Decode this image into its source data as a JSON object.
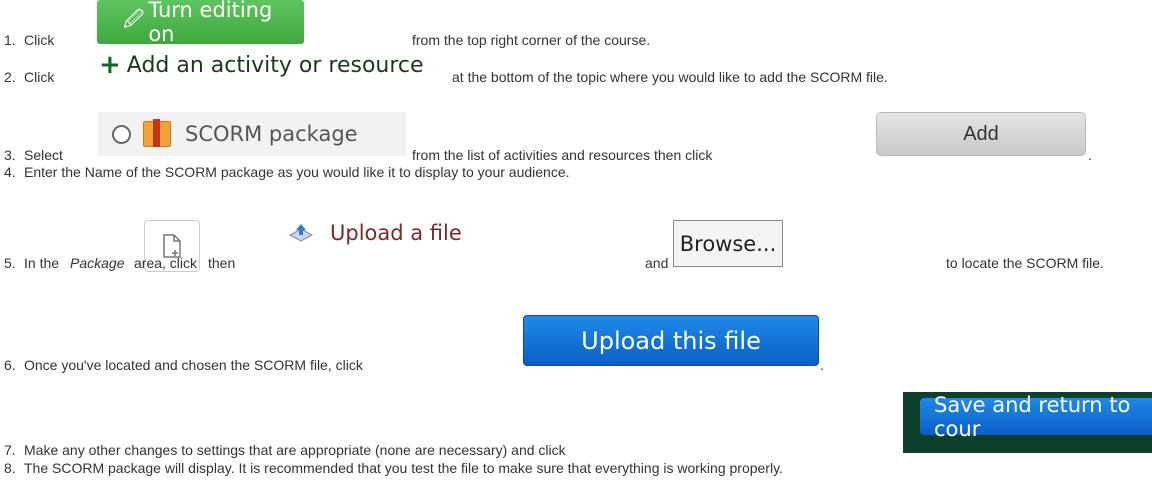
{
  "steps": [
    {
      "num": "1.",
      "text_a": "Click",
      "text_b": "from the top right corner of the course."
    },
    {
      "num": "2.",
      "text_a": "Click",
      "text_b": "at the bottom of the topic where you would like to add the SCORM file."
    },
    {
      "num": "3.",
      "text_a": "Select",
      "text_b": "from the list of activities and resources then click",
      "text_c": "."
    },
    {
      "num": "4.",
      "text_a": "Enter the Name of the SCORM package as you would like it to display to your audience."
    },
    {
      "num": "5.",
      "text_a": "In the",
      "italic": "Package",
      "text_b": "area, click",
      "text_c": "then",
      "text_d": "and",
      "text_e": "to locate the SCORM file."
    },
    {
      "num": "6.",
      "text_a": "Once you've located and chosen the SCORM file, click",
      "text_b": "."
    },
    {
      "num": "7.",
      "text_a": "Make any other changes to settings that are appropriate (none are necessary) and click"
    },
    {
      "num": "8.",
      "text_a": "The SCORM package will display. It is recommended that you test the file to make sure that everything is working properly."
    }
  ],
  "buttons": {
    "turn_editing_on": "Turn editing on",
    "add_activity": "Add an activity or resource",
    "scorm_package": "SCORM package",
    "add": "Add",
    "upload_a_file": "Upload a file",
    "browse": "Browse...",
    "upload_this_file": "Upload this file",
    "save_and_return": "Save and return to cour"
  },
  "icons": {
    "edit": "edit-icon",
    "plus": "plus-icon",
    "radio": "radio-icon",
    "scorm_box": "scorm-package-icon",
    "new_file": "new-file-icon",
    "upload": "upload-icon"
  },
  "colors": {
    "edit_button": "#4cb84c",
    "upload_button": "#1572d8",
    "save_background": "#0e3f2a"
  }
}
